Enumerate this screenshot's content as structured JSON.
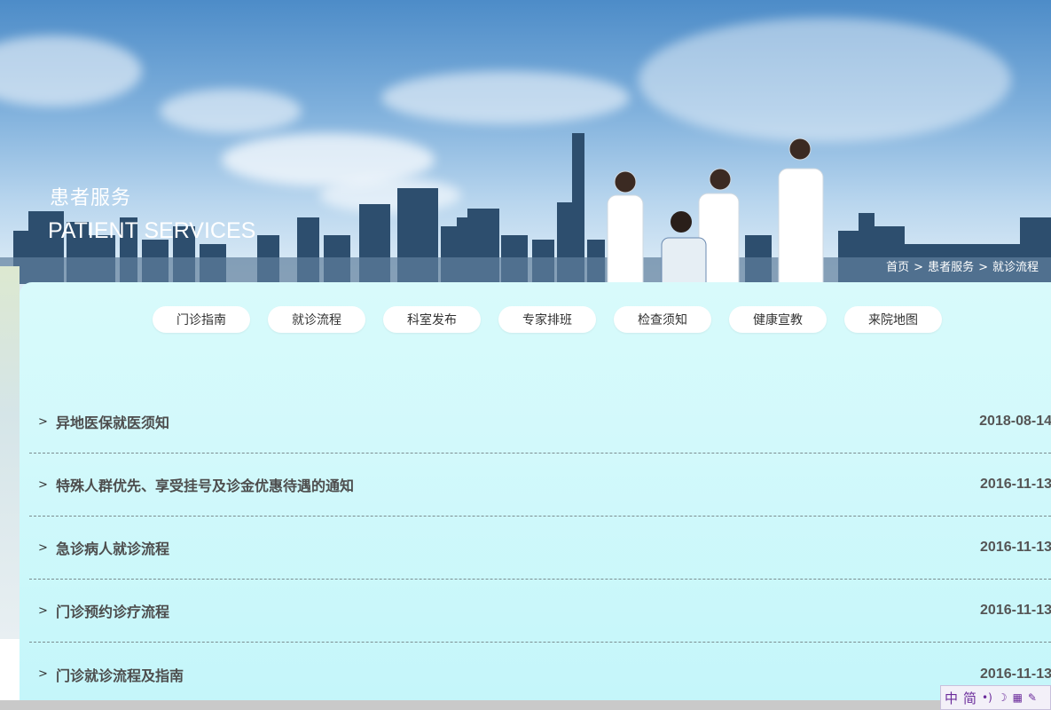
{
  "banner": {
    "title_cn": "患者服务",
    "title_en": "PATIENT SERVICES"
  },
  "breadcrumb": {
    "items": [
      "首页",
      "患者服务",
      "就诊流程"
    ],
    "separator": ">"
  },
  "nav": {
    "items": [
      {
        "label": "门诊指南"
      },
      {
        "label": "就诊流程"
      },
      {
        "label": "科室发布"
      },
      {
        "label": "专家排班"
      },
      {
        "label": "检查须知"
      },
      {
        "label": "健康宣教"
      },
      {
        "label": "来院地图"
      }
    ]
  },
  "list": {
    "bullet": ">",
    "items": [
      {
        "title": "异地医保就医须知",
        "date": "2018-08-14"
      },
      {
        "title": "特殊人群优先、享受挂号及诊金优惠待遇的通知",
        "date": "2016-11-13"
      },
      {
        "title": "急诊病人就诊流程",
        "date": "2016-11-13"
      },
      {
        "title": "门诊预约诊疗流程",
        "date": "2016-11-13"
      },
      {
        "title": "门诊就诊流程及指南",
        "date": "2016-11-13"
      }
    ]
  },
  "toolbar": {
    "lang_zh": "中",
    "lang_simplified": "简",
    "icons": [
      "voice-icon",
      "moon-icon",
      "keyboard-icon",
      "settings-icon"
    ]
  },
  "colors": {
    "panel_bg": "#d2f9fb",
    "title_text": "#4d4d4d",
    "divider": "#7b8d90"
  }
}
